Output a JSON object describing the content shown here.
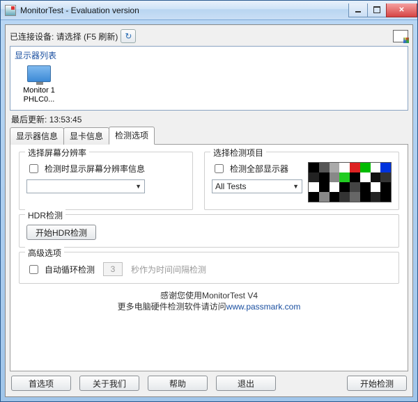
{
  "window": {
    "title": "MonitorTest - Evaluation version"
  },
  "toolbar": {
    "connected_label": "已连接设备: 请选择 (F5 刷新)"
  },
  "monitor_list": {
    "title": "显示器列表",
    "items": [
      {
        "name": "Monitor 1",
        "model": "PHLC0..."
      }
    ]
  },
  "last_update": {
    "label": "最后更新:",
    "time": "13:53:45"
  },
  "tabs": [
    {
      "label": "显示器信息"
    },
    {
      "label": "显卡信息"
    },
    {
      "label": "检测选项"
    }
  ],
  "resolution_group": {
    "legend": "选择屏幕分辨率",
    "checkbox_label": "检测时显示屏幕分辨率信息",
    "combo_value": ""
  },
  "tests_group": {
    "legend": "选择检测项目",
    "checkbox_label": "检测全部显示器",
    "combo_value": "All Tests"
  },
  "hdr_group": {
    "legend": "HDR检测",
    "button_label": "开始HDR检测"
  },
  "advanced_group": {
    "legend": "高级选项",
    "checkbox_label": "自动循环检测",
    "spin_value": "3",
    "suffix": "秒作为时间间隔检测"
  },
  "footer": {
    "line1": "感谢您使用MonitorTest V4",
    "line2_prefix": "更多电脑硬件检测软件请访问",
    "link_text": "www.passmark.com"
  },
  "buttons": {
    "prefs": "首选项",
    "about": "关于我们",
    "help": "帮助",
    "exit": "退出",
    "start": "开始检测"
  },
  "pattern_colors": [
    "#000",
    "#555",
    "#aaa",
    "#fff",
    "#d22",
    "#0b0",
    "#fff",
    "#03d",
    "#222",
    "#000",
    "#888",
    "#2c2",
    "#000",
    "#fff",
    "#111",
    "#333",
    "#fff",
    "#000",
    "#fff",
    "#000",
    "#444",
    "#000",
    "#fff",
    "#000",
    "#000",
    "#888",
    "#000",
    "#333",
    "#666",
    "#000",
    "#222",
    "#000"
  ]
}
